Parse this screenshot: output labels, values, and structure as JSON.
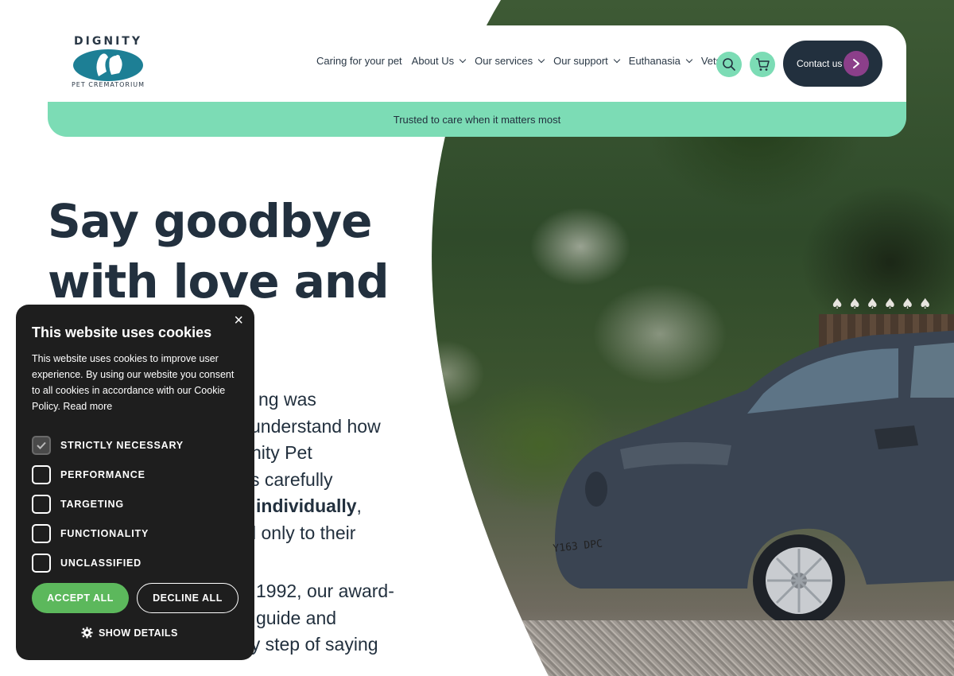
{
  "brand": {
    "logo_top": "DIGNITY",
    "logo_bottom": "PET CREMATORIUM"
  },
  "nav": {
    "items": [
      {
        "label": "Caring for your pet",
        "dropdown": false
      },
      {
        "label": "About Us",
        "dropdown": true
      },
      {
        "label": "Our services",
        "dropdown": true
      },
      {
        "label": "Our support",
        "dropdown": true
      },
      {
        "label": "Euthanasia",
        "dropdown": true
      },
      {
        "label": "Vets",
        "dropdown": true
      }
    ],
    "search_icon": "search-icon",
    "cart_icon": "cart-icon",
    "contact_label": "Contact us"
  },
  "banner": {
    "text": "Trusted to care when it matters most"
  },
  "hero": {
    "title_line1": "Say goodbye",
    "title_line2": "with love and",
    "body_lines": [
      "ng was",
      "understand how",
      "nity Pet",
      "s carefully",
      "individually",
      "l only to their"
    ],
    "body2_lines": [
      "1992, our award-",
      "guide and",
      "support you through every step of saying"
    ]
  },
  "cookie": {
    "title": "This website uses cookies",
    "text": "This website uses cookies to improve user experience. By using our website you consent to all cookies in accordance with our Cookie Policy.",
    "read_more": "Read more",
    "options": [
      {
        "label": "STRICTLY NECESSARY",
        "checked": true
      },
      {
        "label": "PERFORMANCE",
        "checked": false
      },
      {
        "label": "TARGETING",
        "checked": false
      },
      {
        "label": "FUNCTIONALITY",
        "checked": false
      },
      {
        "label": "UNCLASSIFIED",
        "checked": false
      }
    ],
    "accept_label": "ACCEPT ALL",
    "decline_label": "DECLINE ALL",
    "details_label": "SHOW DETAILS",
    "close_symbol": "×"
  },
  "vehicle": {
    "plate": "Y163 DPC"
  },
  "colors": {
    "navy": "#22303e",
    "mint": "#7cdcb5",
    "purple": "#8c3f8a",
    "logo_teal": "#1d7f95",
    "accept_green": "#5cb85c",
    "cookie_bg": "#1e1e1e"
  }
}
